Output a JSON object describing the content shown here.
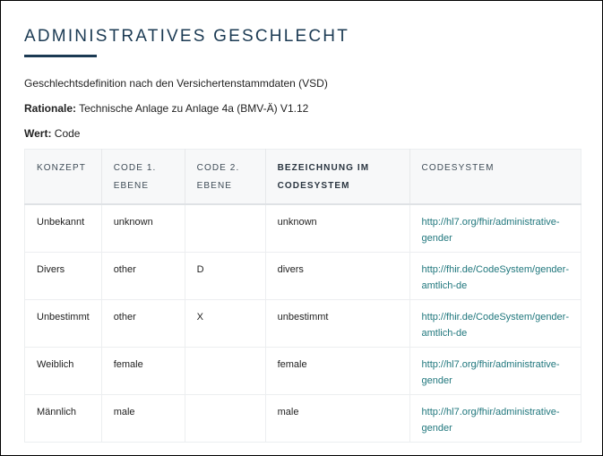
{
  "heading": "ADMINISTRATIVES GESCHLECHT",
  "description": "Geschlechtsdefinition nach den Versichertenstammdaten (VSD)",
  "rationale": {
    "label": "Rationale:",
    "value": " Technische Anlage zu Anlage 4a (BMV-Ä) V1.12"
  },
  "wert": {
    "label": "Wert:",
    "value": " Code"
  },
  "table": {
    "headers": [
      "KONZEPT",
      "CODE 1. EBENE",
      "CODE 2. EBENE",
      "BEZEICHNUNG IM CODESYSTEM",
      "CODESYSTEM"
    ],
    "rows": [
      [
        "Unbekannt",
        "unknown",
        "",
        "unknown",
        "http://hl7.org/fhir/administrative-gender"
      ],
      [
        "Divers",
        "other",
        "D",
        "divers",
        "http://fhir.de/CodeSystem/gender-amtlich-de"
      ],
      [
        "Unbestimmt",
        "other",
        "X",
        "unbestimmt",
        "http://fhir.de/CodeSystem/gender-amtlich-de"
      ],
      [
        "Weiblich",
        "female",
        "",
        "female",
        "http://hl7.org/fhir/administrative-gender"
      ],
      [
        "Männlich",
        "male",
        "",
        "male",
        "http://hl7.org/fhir/administrative-gender"
      ]
    ]
  }
}
